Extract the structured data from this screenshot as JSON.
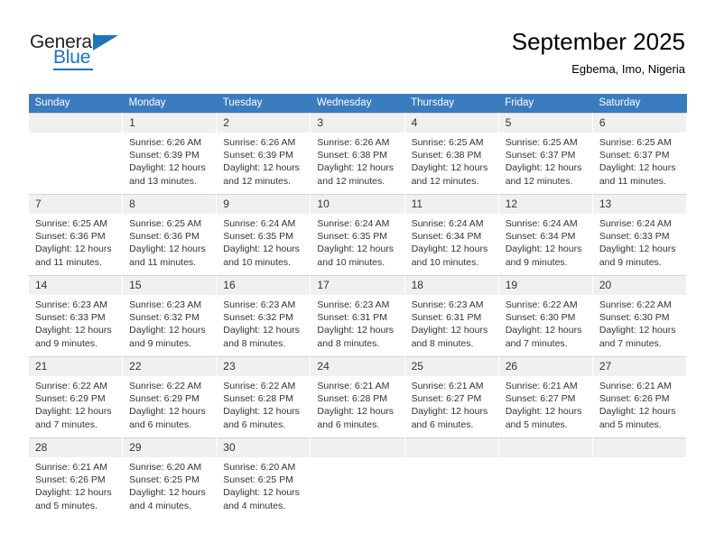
{
  "brand": {
    "name_top": "General",
    "name_bottom": "Blue",
    "accent_color": "#1e73be"
  },
  "header": {
    "title": "September 2025",
    "subtitle": "Egbema, Imo, Nigeria"
  },
  "calendar": {
    "header_color": "#3b7cbf",
    "weekday_headers": [
      "Sunday",
      "Monday",
      "Tuesday",
      "Wednesday",
      "Thursday",
      "Friday",
      "Saturday"
    ],
    "weeks": [
      [
        {
          "day": "",
          "lines": []
        },
        {
          "day": "1",
          "lines": [
            "Sunrise: 6:26 AM",
            "Sunset: 6:39 PM",
            "Daylight: 12 hours",
            "and 13 minutes."
          ]
        },
        {
          "day": "2",
          "lines": [
            "Sunrise: 6:26 AM",
            "Sunset: 6:39 PM",
            "Daylight: 12 hours",
            "and 12 minutes."
          ]
        },
        {
          "day": "3",
          "lines": [
            "Sunrise: 6:26 AM",
            "Sunset: 6:38 PM",
            "Daylight: 12 hours",
            "and 12 minutes."
          ]
        },
        {
          "day": "4",
          "lines": [
            "Sunrise: 6:25 AM",
            "Sunset: 6:38 PM",
            "Daylight: 12 hours",
            "and 12 minutes."
          ]
        },
        {
          "day": "5",
          "lines": [
            "Sunrise: 6:25 AM",
            "Sunset: 6:37 PM",
            "Daylight: 12 hours",
            "and 12 minutes."
          ]
        },
        {
          "day": "6",
          "lines": [
            "Sunrise: 6:25 AM",
            "Sunset: 6:37 PM",
            "Daylight: 12 hours",
            "and 11 minutes."
          ]
        }
      ],
      [
        {
          "day": "7",
          "lines": [
            "Sunrise: 6:25 AM",
            "Sunset: 6:36 PM",
            "Daylight: 12 hours",
            "and 11 minutes."
          ]
        },
        {
          "day": "8",
          "lines": [
            "Sunrise: 6:25 AM",
            "Sunset: 6:36 PM",
            "Daylight: 12 hours",
            "and 11 minutes."
          ]
        },
        {
          "day": "9",
          "lines": [
            "Sunrise: 6:24 AM",
            "Sunset: 6:35 PM",
            "Daylight: 12 hours",
            "and 10 minutes."
          ]
        },
        {
          "day": "10",
          "lines": [
            "Sunrise: 6:24 AM",
            "Sunset: 6:35 PM",
            "Daylight: 12 hours",
            "and 10 minutes."
          ]
        },
        {
          "day": "11",
          "lines": [
            "Sunrise: 6:24 AM",
            "Sunset: 6:34 PM",
            "Daylight: 12 hours",
            "and 10 minutes."
          ]
        },
        {
          "day": "12",
          "lines": [
            "Sunrise: 6:24 AM",
            "Sunset: 6:34 PM",
            "Daylight: 12 hours",
            "and 9 minutes."
          ]
        },
        {
          "day": "13",
          "lines": [
            "Sunrise: 6:24 AM",
            "Sunset: 6:33 PM",
            "Daylight: 12 hours",
            "and 9 minutes."
          ]
        }
      ],
      [
        {
          "day": "14",
          "lines": [
            "Sunrise: 6:23 AM",
            "Sunset: 6:33 PM",
            "Daylight: 12 hours",
            "and 9 minutes."
          ]
        },
        {
          "day": "15",
          "lines": [
            "Sunrise: 6:23 AM",
            "Sunset: 6:32 PM",
            "Daylight: 12 hours",
            "and 9 minutes."
          ]
        },
        {
          "day": "16",
          "lines": [
            "Sunrise: 6:23 AM",
            "Sunset: 6:32 PM",
            "Daylight: 12 hours",
            "and 8 minutes."
          ]
        },
        {
          "day": "17",
          "lines": [
            "Sunrise: 6:23 AM",
            "Sunset: 6:31 PM",
            "Daylight: 12 hours",
            "and 8 minutes."
          ]
        },
        {
          "day": "18",
          "lines": [
            "Sunrise: 6:23 AM",
            "Sunset: 6:31 PM",
            "Daylight: 12 hours",
            "and 8 minutes."
          ]
        },
        {
          "day": "19",
          "lines": [
            "Sunrise: 6:22 AM",
            "Sunset: 6:30 PM",
            "Daylight: 12 hours",
            "and 7 minutes."
          ]
        },
        {
          "day": "20",
          "lines": [
            "Sunrise: 6:22 AM",
            "Sunset: 6:30 PM",
            "Daylight: 12 hours",
            "and 7 minutes."
          ]
        }
      ],
      [
        {
          "day": "21",
          "lines": [
            "Sunrise: 6:22 AM",
            "Sunset: 6:29 PM",
            "Daylight: 12 hours",
            "and 7 minutes."
          ]
        },
        {
          "day": "22",
          "lines": [
            "Sunrise: 6:22 AM",
            "Sunset: 6:29 PM",
            "Daylight: 12 hours",
            "and 6 minutes."
          ]
        },
        {
          "day": "23",
          "lines": [
            "Sunrise: 6:22 AM",
            "Sunset: 6:28 PM",
            "Daylight: 12 hours",
            "and 6 minutes."
          ]
        },
        {
          "day": "24",
          "lines": [
            "Sunrise: 6:21 AM",
            "Sunset: 6:28 PM",
            "Daylight: 12 hours",
            "and 6 minutes."
          ]
        },
        {
          "day": "25",
          "lines": [
            "Sunrise: 6:21 AM",
            "Sunset: 6:27 PM",
            "Daylight: 12 hours",
            "and 6 minutes."
          ]
        },
        {
          "day": "26",
          "lines": [
            "Sunrise: 6:21 AM",
            "Sunset: 6:27 PM",
            "Daylight: 12 hours",
            "and 5 minutes."
          ]
        },
        {
          "day": "27",
          "lines": [
            "Sunrise: 6:21 AM",
            "Sunset: 6:26 PM",
            "Daylight: 12 hours",
            "and 5 minutes."
          ]
        }
      ],
      [
        {
          "day": "28",
          "lines": [
            "Sunrise: 6:21 AM",
            "Sunset: 6:26 PM",
            "Daylight: 12 hours",
            "and 5 minutes."
          ]
        },
        {
          "day": "29",
          "lines": [
            "Sunrise: 6:20 AM",
            "Sunset: 6:25 PM",
            "Daylight: 12 hours",
            "and 4 minutes."
          ]
        },
        {
          "day": "30",
          "lines": [
            "Sunrise: 6:20 AM",
            "Sunset: 6:25 PM",
            "Daylight: 12 hours",
            "and 4 minutes."
          ]
        },
        {
          "day": "",
          "lines": []
        },
        {
          "day": "",
          "lines": []
        },
        {
          "day": "",
          "lines": []
        },
        {
          "day": "",
          "lines": []
        }
      ]
    ]
  }
}
